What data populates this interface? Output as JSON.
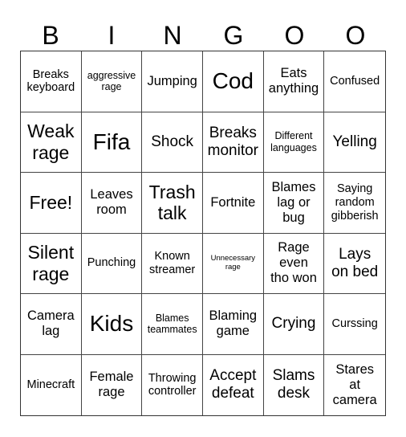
{
  "header": [
    "B",
    "I",
    "N",
    "G",
    "O",
    "O"
  ],
  "cells": [
    {
      "text": "Breaks\nkeyboard",
      "size": 3
    },
    {
      "text": "aggressive\nrage",
      "size": 2
    },
    {
      "text": "Jumping",
      "size": 4
    },
    {
      "text": "Cod",
      "size": 7
    },
    {
      "text": "Eats\nanything",
      "size": 4
    },
    {
      "text": "Confused",
      "size": 3
    },
    {
      "text": "Weak\nrage",
      "size": 6
    },
    {
      "text": "Fifa",
      "size": 7
    },
    {
      "text": "Shock",
      "size": 5
    },
    {
      "text": "Breaks\nmonitor",
      "size": 5
    },
    {
      "text": "Different\nlanguages",
      "size": 2
    },
    {
      "text": "Yelling",
      "size": 5
    },
    {
      "text": "Free!",
      "size": 6
    },
    {
      "text": "Leaves\nroom",
      "size": 4
    },
    {
      "text": "Trash\ntalk",
      "size": 6
    },
    {
      "text": "Fortnite",
      "size": 4
    },
    {
      "text": "Blames\nlag or\nbug",
      "size": 4
    },
    {
      "text": "Saying\nrandom\ngibberish",
      "size": 3
    },
    {
      "text": "Silent\nrage",
      "size": 6
    },
    {
      "text": "Punching",
      "size": 3
    },
    {
      "text": "Known\nstreamer",
      "size": 3
    },
    {
      "text": "Unnecessary\nrage",
      "size": 1
    },
    {
      "text": "Rage\neven\ntho won",
      "size": 4
    },
    {
      "text": "Lays\non bed",
      "size": 5
    },
    {
      "text": "Camera\nlag",
      "size": 4
    },
    {
      "text": "Kids",
      "size": 7
    },
    {
      "text": "Blames\nteammates",
      "size": 2
    },
    {
      "text": "Blaming\ngame",
      "size": 4
    },
    {
      "text": "Crying",
      "size": 5
    },
    {
      "text": "Curssing",
      "size": 3
    },
    {
      "text": "Minecraft",
      "size": 3
    },
    {
      "text": "Female\nrage",
      "size": 4
    },
    {
      "text": "Throwing\ncontroller",
      "size": 3
    },
    {
      "text": "Accept\ndefeat",
      "size": 5
    },
    {
      "text": "Slams\ndesk",
      "size": 5
    },
    {
      "text": "Stares\nat\ncamera",
      "size": 4
    }
  ]
}
